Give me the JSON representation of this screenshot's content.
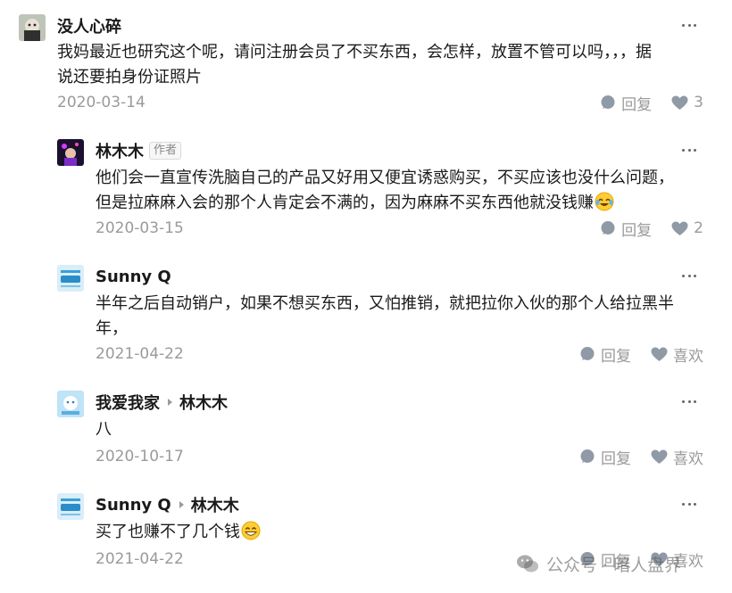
{
  "comments": [
    {
      "user": "没人心碎",
      "text": "我妈最近也研究这个呢，请问注册会员了不买东西，会怎样，放置不管可以吗，，，据说还要拍身份证照片",
      "text_lines": [
        "我妈最近也研究这个呢，请问注册会员了不买东西，会怎样，放置不管可以吗，，，据",
        "说还要拍身份证照片"
      ],
      "date": "2020-03-14",
      "reply_label": "回复",
      "like_label": "3"
    },
    {
      "user": "林木木",
      "badge": "作者",
      "text_lines": [
        "他们会一直宣传洗脑自己的产品又好用又便宜诱惑购买，不买应该也没什么问题，",
        "但是拉麻麻入会的那个人肯定会不满的，因为麻麻不买东西他就没钱赚"
      ],
      "emoji": "laugh-cry-emoji",
      "date": "2020-03-15",
      "reply_label": "回复",
      "like_label": "2"
    },
    {
      "user": "Sunny Q",
      "text_lines": [
        "半年之后自动销户，如果不想买东西，又怕推销，就把拉你入伙的那个人给拉黑半",
        "年，"
      ],
      "date": "2021-04-22",
      "reply_label": "回复",
      "like_label": "喜欢"
    },
    {
      "user": "我爱我家",
      "reply_to": "林木木",
      "text_lines": [
        "八"
      ],
      "date": "2020-10-17",
      "reply_label": "回复",
      "like_label": "喜欢"
    },
    {
      "user": "Sunny Q",
      "reply_to": "林木木",
      "text_lines": [
        "买了也赚不了几个钱"
      ],
      "emoji": "grin-emoji",
      "date": "2021-04-22",
      "reply_label": "回复",
      "like_label": "喜欢"
    }
  ],
  "watermark": "公众号 · 暗人盘界",
  "colors": {
    "meta": "#9a9a9a",
    "text": "#1a1a1a",
    "icon": "#8f9aa6"
  }
}
